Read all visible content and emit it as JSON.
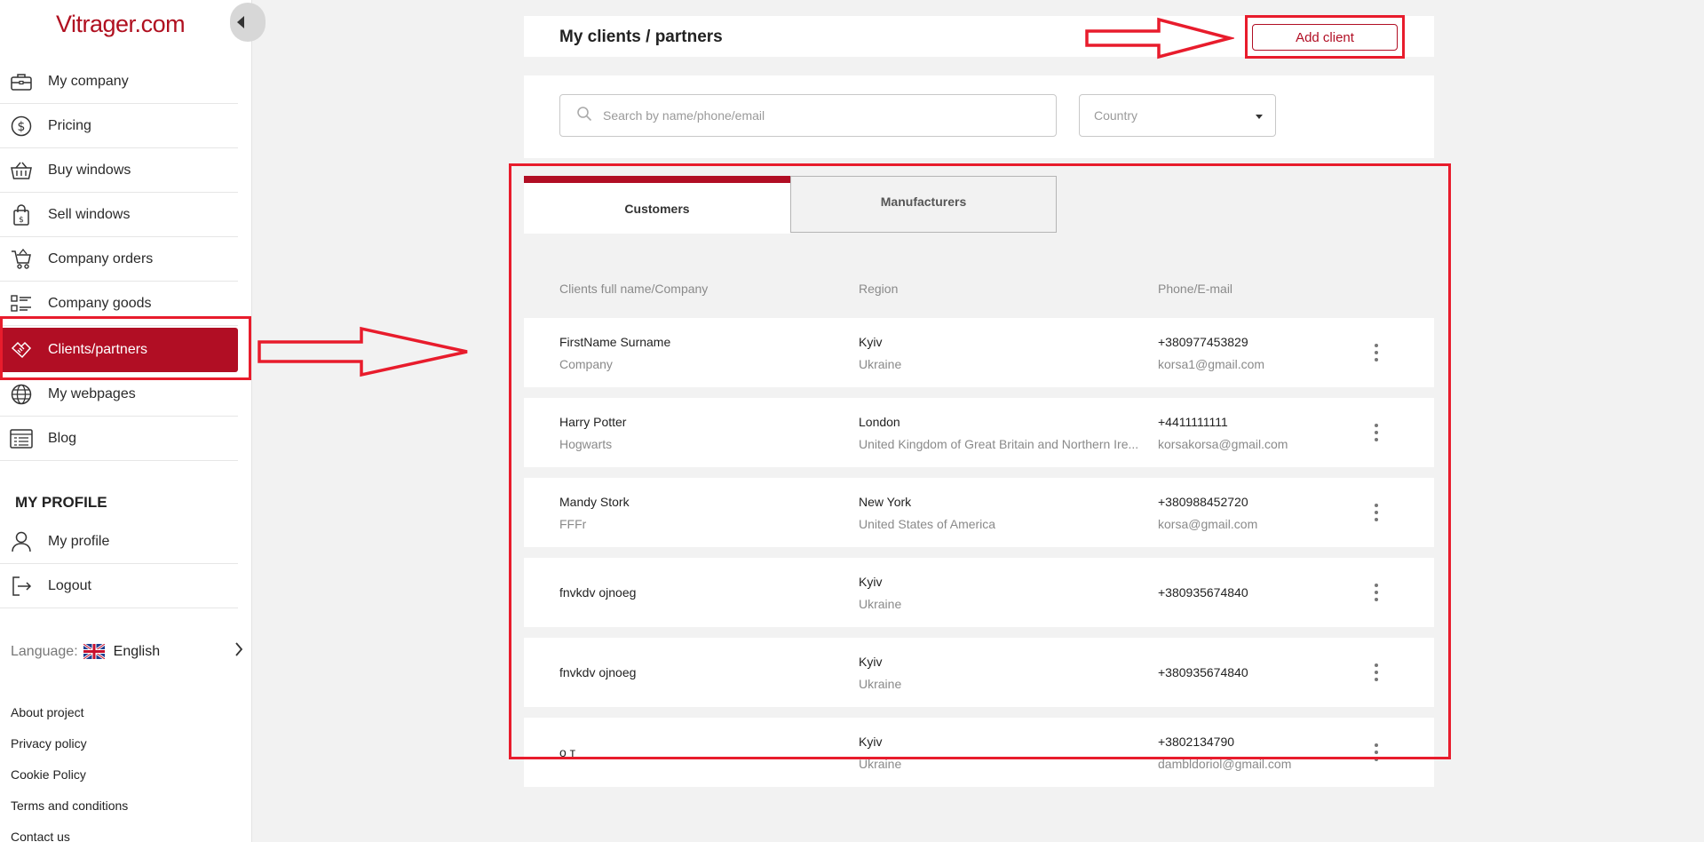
{
  "app": {
    "logo": "Vitrager.com"
  },
  "sidebar": {
    "items": [
      {
        "label": "My company",
        "icon": "briefcase-icon"
      },
      {
        "label": "Pricing",
        "icon": "dollar-icon"
      },
      {
        "label": "Buy windows",
        "icon": "basket-icon"
      },
      {
        "label": "Sell windows",
        "icon": "shopping-bag-icon"
      },
      {
        "label": "Company orders",
        "icon": "cart-icon"
      },
      {
        "label": "Company goods",
        "icon": "goods-list-icon"
      },
      {
        "label": "Clients/partners",
        "icon": "handshake-icon",
        "active": true
      },
      {
        "label": "My webpages",
        "icon": "globe-icon"
      },
      {
        "label": "Blog",
        "icon": "blog-icon"
      }
    ],
    "profile_title": "MY PROFILE",
    "profile_items": [
      {
        "label": "My profile",
        "icon": "user-icon"
      },
      {
        "label": "Logout",
        "icon": "logout-icon"
      }
    ],
    "language_label": "Language:",
    "language_value": "English",
    "footer_links": [
      "About project",
      "Privacy policy",
      "Cookie Policy",
      "Terms and conditions",
      "Contact us"
    ]
  },
  "header": {
    "title": "My clients / partners",
    "add_button": "Add client"
  },
  "filters": {
    "search_placeholder": "Search by name/phone/email",
    "country_placeholder": "Country"
  },
  "tabs": [
    {
      "label": "Customers",
      "active": true
    },
    {
      "label": "Manufacturers",
      "active": false
    }
  ],
  "table": {
    "columns": [
      "Clients full name/Company",
      "Region",
      "Phone/E-mail"
    ],
    "rows": [
      {
        "name": "FirstName Surname",
        "company": "Company",
        "city": "Kyiv",
        "country": "Ukraine",
        "phone": "+380977453829",
        "email": "korsa1@gmail.com"
      },
      {
        "name": "Harry Potter",
        "company": "Hogwarts",
        "city": "London",
        "country": "United Kingdom of Great Britain and Northern Ire...",
        "phone": "+4411111111",
        "email": "korsakorsa@gmail.com"
      },
      {
        "name": "Mandy Stork",
        "company": "FFFr",
        "city": "New York",
        "country": "United States of America",
        "phone": "+380988452720",
        "email": "korsa@gmail.com"
      },
      {
        "name": "fnvkdv ojnoeg",
        "company": "",
        "city": "Kyiv",
        "country": "Ukraine",
        "phone": "+380935674840",
        "email": ""
      },
      {
        "name": "fnvkdv ojnoeg",
        "company": "",
        "city": "Kyiv",
        "country": "Ukraine",
        "phone": "+380935674840",
        "email": ""
      },
      {
        "name": "o т",
        "company": "",
        "city": "Kyiv",
        "country": "Ukraine",
        "phone": "+3802134790",
        "email": "dambldoriol@gmail.com"
      }
    ]
  },
  "colors": {
    "brand": "#b10e24",
    "annotation": "#e81c2c"
  }
}
